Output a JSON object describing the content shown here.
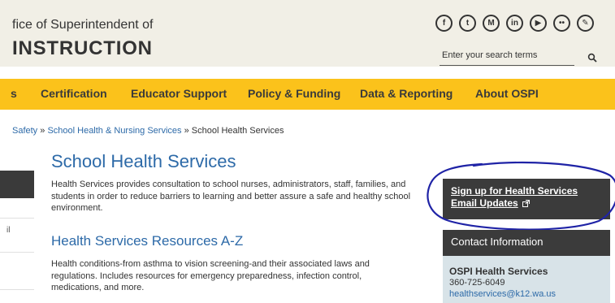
{
  "header": {
    "org_line1": "fice of Superintendent of",
    "org_line2": "INSTRUCTION",
    "social_icons": [
      "facebook-icon",
      "twitter-icon",
      "medium-icon",
      "linkedin-icon",
      "youtube-icon",
      "flickr-icon",
      "blog-icon"
    ],
    "search_placeholder": "Enter your search terms"
  },
  "nav": {
    "items": [
      "s",
      "Certification",
      "Educator Support",
      "Policy & Funding",
      "Data & Reporting",
      "About OSPI"
    ]
  },
  "breadcrumb": {
    "items": [
      "Safety",
      "School Health & Nursing Services",
      "School Health Services"
    ],
    "separator": "»"
  },
  "left_rail": {
    "fragment": "il"
  },
  "main": {
    "title": "School Health Services",
    "intro": "Health Services provides consultation to school nurses, administrators, staff, families, and students in order to reduce barriers to learning and better assure a safe and healthy school environment.",
    "section_title": "Health Services Resources A-Z",
    "section_desc": "Health conditions-from asthma to vision screening-and their associated laws and regulations. Includes resources for emergency preparedness, infection control, medications, and more."
  },
  "sidebar": {
    "signup_text": "Sign up for Health Services Email Updates",
    "contact_header": "Contact Information",
    "contact_name": "OSPI Health Services",
    "contact_phone": "360-725-6049",
    "contact_email": "healthservices@k12.wa.us"
  },
  "colors": {
    "nav_bg": "#fbc21b",
    "header_bg": "#f1efe6",
    "link_blue": "#2d6aa8",
    "sidebar_dark": "#3b3b3b",
    "contact_bg": "#d8e3e8",
    "annotation_blue": "#1f23a6"
  }
}
